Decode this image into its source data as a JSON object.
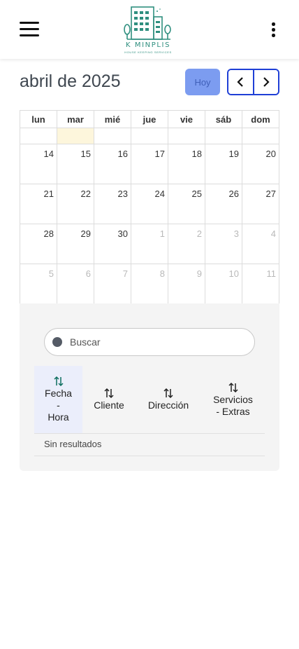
{
  "header": {
    "brand_name": "K MINPLIS",
    "brand_tagline": "HOUSE KEEPING SERVICES",
    "menu_icon": "hamburger-icon",
    "more_icon": "kebab-vertical-icon"
  },
  "calendar": {
    "title": "abril de 2025",
    "today_label": "Hoy",
    "prev_icon": "chevron-left-icon",
    "next_icon": "chevron-right-icon",
    "weekdays": [
      "lun",
      "mar",
      "mié",
      "jue",
      "vie",
      "sáb",
      "dom"
    ],
    "weeks": [
      [
        "",
        "",
        "",
        "",
        "",
        "",
        ""
      ],
      [
        "14",
        "15",
        "16",
        "17",
        "18",
        "19",
        "20"
      ],
      [
        "21",
        "22",
        "23",
        "24",
        "25",
        "26",
        "27"
      ],
      [
        "28",
        "29",
        "30",
        "1",
        "2",
        "3",
        "4"
      ],
      [
        "5",
        "6",
        "7",
        "8",
        "9",
        "10",
        "11"
      ]
    ]
  },
  "table": {
    "search_placeholder": "Buscar",
    "columns": [
      {
        "line1": "Fecha",
        "line2": "-",
        "line3": "Hora"
      },
      {
        "line1": "Cliente"
      },
      {
        "line1": "Dirección"
      },
      {
        "line1": "Servicios",
        "line2": "- Extras"
      }
    ],
    "empty_message": "Sin resultados"
  },
  "colors": {
    "accent": "#1f3fd6",
    "today_button": "#7c9cf0",
    "today_cell": "#fdf6dc",
    "brand": "#2f8f7f",
    "active_header": "#ebeefb"
  }
}
